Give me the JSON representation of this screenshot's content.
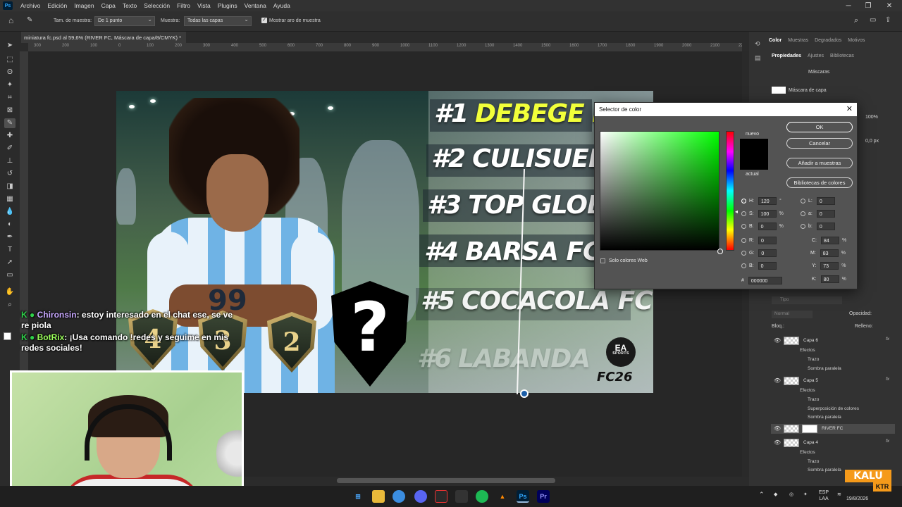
{
  "menubar": {
    "items": [
      "Archivo",
      "Edición",
      "Imagen",
      "Capa",
      "Texto",
      "Selección",
      "Filtro",
      "Vista",
      "Plugins",
      "Ventana",
      "Ayuda"
    ]
  },
  "options": {
    "sample_size_label": "Tam. de muestra:",
    "sample_size_value": "De 1 punto",
    "sample_label": "Muestra:",
    "sample_value": "Todas las capas",
    "ring_label": "Mostrar aro de muestra"
  },
  "document": {
    "tab_title": "miniatura fc.psd al 59,6% (RIVER FC, Máscara de capa/8/CMYK) *"
  },
  "ruler": {
    "ticks": [
      "300",
      "200",
      "100",
      "0",
      "100",
      "200",
      "300",
      "400",
      "500",
      "600",
      "700",
      "800",
      "900",
      "1000",
      "1100",
      "1200",
      "1300",
      "1400",
      "1500",
      "1600",
      "1700",
      "1800",
      "1900",
      "2000",
      "2100",
      "2200"
    ]
  },
  "thumbnail": {
    "ranks": [
      {
        "num": "#1",
        "name": "DEBEGE FC"
      },
      {
        "num": "#2",
        "name": "CULISUELTA"
      },
      {
        "num": "#3",
        "name": "TOP GLOBA"
      },
      {
        "num": "#4",
        "name": "BARSA FC"
      },
      {
        "num": "#5",
        "name": "COCACOLA FC"
      },
      {
        "num": "#6",
        "name": "LABANDA"
      }
    ],
    "shields": [
      "4",
      "3",
      "2"
    ],
    "mystery": "?",
    "jersey_number": "99",
    "ea_logo": "EA",
    "ea_sub": "SPORTS",
    "fc_logo": "FC26",
    "colors": {
      "highlight": "#f2ff3a"
    }
  },
  "chat": {
    "msg1_user": "Chironsin",
    "msg1_text": ": estoy interesado en el chat ese, se ve re piola",
    "msg2_user": "BotRix",
    "msg2_text": ": ¡Usa comando !redes y seguime en mis redes sociales!"
  },
  "right_panel": {
    "top_tabs": [
      "Color",
      "Muestras",
      "Degradados",
      "Motivos"
    ],
    "prop_tabs": [
      "Propiedades",
      "Ajustes",
      "Bibliotecas"
    ],
    "masks_label": "Máscaras",
    "layer_mask_label": "Máscara de capa",
    "density": "100%",
    "feather": "0,0 px",
    "layers_search": "Tipo",
    "blend_mode": "Normal",
    "opacity_label": "Opacidad:",
    "lock_label": "Bloq.:",
    "fill_label": "Relleno:"
  },
  "layers": [
    {
      "name": "Capa 6",
      "fx": "fx",
      "subs": [
        "Efectos",
        "Trazo",
        "Sombra paralela"
      ]
    },
    {
      "name": "Capa 5",
      "fx": "fx",
      "subs": [
        "Efectos",
        "Trazo",
        "Superposición de colores",
        "Sombra paralela"
      ]
    },
    {
      "name": "RIVER FC",
      "fx": "",
      "subs": []
    },
    {
      "name": "Capa 4",
      "fx": "fx",
      "subs": [
        "Efectos",
        "Trazo",
        "Sombra paralela"
      ]
    }
  ],
  "color_picker": {
    "title": "Selector de color",
    "new_label": "nuevo",
    "current_label": "actual",
    "ok": "OK",
    "cancel": "Cancelar",
    "add_swatch": "Añadir a muestras",
    "libraries": "Bibliotecas de colores",
    "web_only": "Solo colores Web",
    "H": "120",
    "H_unit": "°",
    "S": "100",
    "S_unit": "%",
    "B": "0",
    "B_unit": "%",
    "R": "0",
    "G": "0",
    "Bl": "0",
    "L": "0",
    "a": "0",
    "b": "0",
    "C": "84",
    "M": "83",
    "Y": "73",
    "K": "80",
    "pct": "%",
    "hex": "000000",
    "hex_label": "#"
  },
  "taskbar": {
    "lang": "ESP",
    "lang2": "LAA",
    "date": "19/8/2026",
    "ps_label": "Ps",
    "pr_label": "Pr"
  },
  "overlay": {
    "brand": "KALU",
    "brand_sub": "KTR"
  }
}
